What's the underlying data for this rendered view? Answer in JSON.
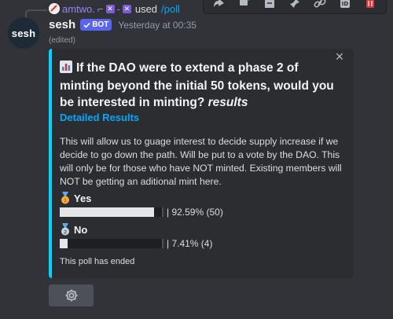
{
  "reply": {
    "username": "amtwo.",
    "command_prefix": "used",
    "command": "/poll"
  },
  "toolbar": {
    "icons": [
      "add-reaction-icon",
      "reply-icon",
      "forward-icon",
      "edit-icon",
      "pin-icon",
      "link-icon",
      "id-icon",
      "delete-icon"
    ]
  },
  "message": {
    "avatar_text": "sesh",
    "username": "sesh",
    "bot_tag": "BOT",
    "timestamp": "Yesterday at 00:35",
    "edited": "(edited)"
  },
  "embed": {
    "accent_color": "#00d5ff",
    "title": "If the DAO were to extend a phase 2 of minting beyond the initial 50 tokens, would you be interested in minting?",
    "title_suffix": "results",
    "link_text": "Detailed Results",
    "description": "This will allow us to guage interest to decide supply increase if we decide to go down the path. Will be put to a vote by the DAO. This will only be for those who have NOT minted. Existing members will NOT be getting an aditional mint here.",
    "options": [
      {
        "label": "Yes",
        "medal": "gold",
        "percent": 92.59,
        "text": "| 92.59% (50)"
      },
      {
        "label": "No",
        "medal": "silver",
        "percent": 7.41,
        "text": "| 7.41% (4)"
      }
    ],
    "footer": "This poll has ended"
  },
  "button": {
    "icon": "gear-icon"
  }
}
